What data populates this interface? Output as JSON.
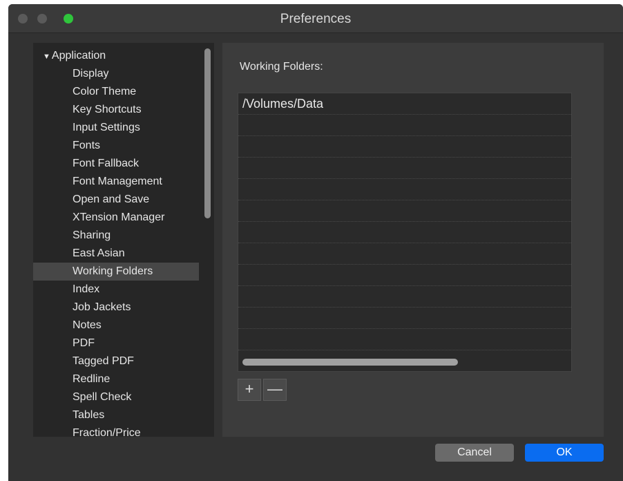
{
  "window": {
    "title": "Preferences"
  },
  "sidebar": {
    "group_label": "Application",
    "group_icon": "triangle-down-icon",
    "items": [
      {
        "label": "Display"
      },
      {
        "label": "Color Theme"
      },
      {
        "label": "Key Shortcuts"
      },
      {
        "label": "Input Settings"
      },
      {
        "label": "Fonts"
      },
      {
        "label": "Font Fallback"
      },
      {
        "label": "Font Management"
      },
      {
        "label": "Open and Save"
      },
      {
        "label": "XTension Manager"
      },
      {
        "label": "Sharing"
      },
      {
        "label": "East Asian"
      },
      {
        "label": "Working Folders",
        "selected": true
      },
      {
        "label": "Index"
      },
      {
        "label": "Job Jackets"
      },
      {
        "label": "Notes"
      },
      {
        "label": "PDF"
      },
      {
        "label": "Tagged PDF"
      },
      {
        "label": "Redline"
      },
      {
        "label": "Spell Check"
      },
      {
        "label": "Tables"
      },
      {
        "label": "Fraction/Price"
      }
    ]
  },
  "main": {
    "section_label": "Working Folders:",
    "folders": [
      "/Volumes/Data"
    ],
    "add_label": "+",
    "remove_label": "—"
  },
  "footer": {
    "cancel_label": "Cancel",
    "ok_label": "OK"
  },
  "colors": {
    "accent": "#0a6cf0",
    "maximize": "#2fc53c"
  }
}
